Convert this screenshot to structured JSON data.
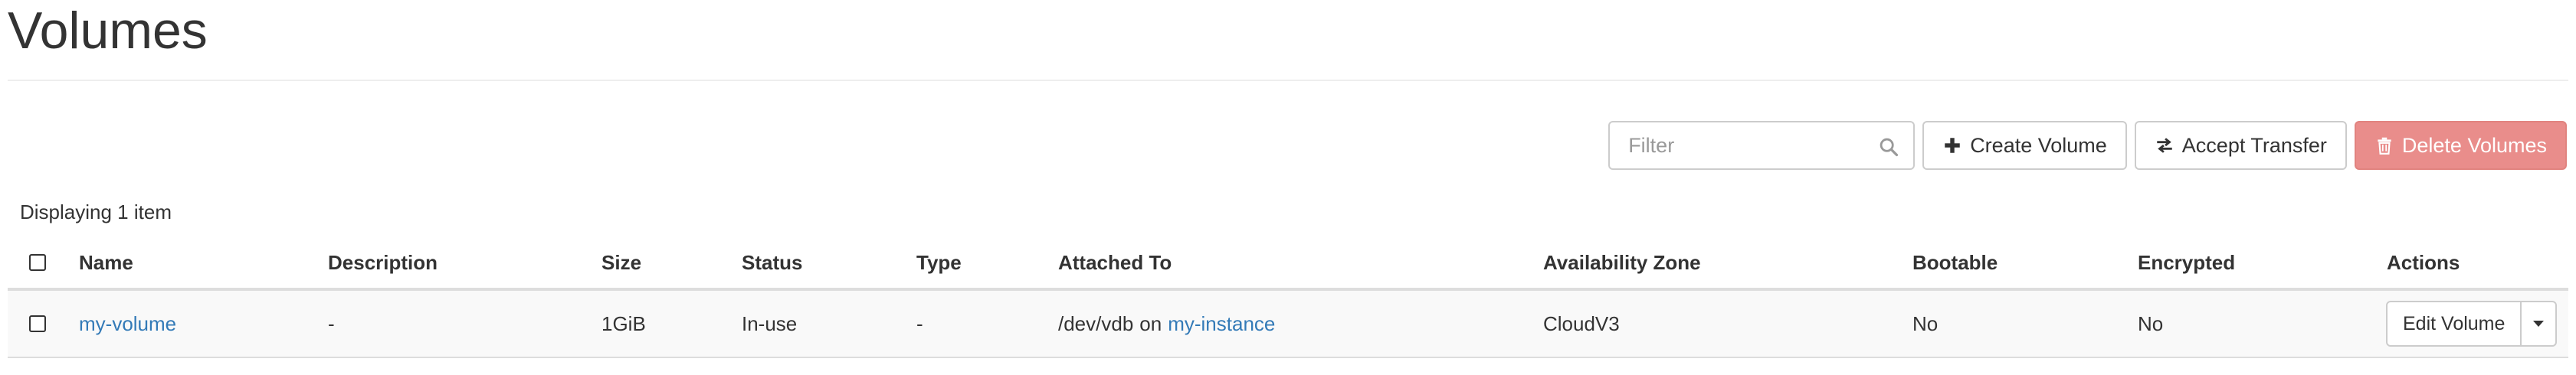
{
  "page": {
    "title": "Volumes"
  },
  "toolbar": {
    "filter_placeholder": "Filter",
    "create_label": "Create Volume",
    "accept_label": "Accept Transfer",
    "delete_label": "Delete Volumes"
  },
  "table": {
    "count_text": "Displaying 1 item",
    "headers": {
      "name": "Name",
      "description": "Description",
      "size": "Size",
      "status": "Status",
      "type": "Type",
      "attached": "Attached To",
      "zone": "Availability Zone",
      "bootable": "Bootable",
      "encrypted": "Encrypted",
      "actions": "Actions"
    },
    "rows": [
      {
        "name": "my-volume",
        "description": "-",
        "size": "1GiB",
        "status": "In-use",
        "type": "-",
        "attached_path": "/dev/vdb",
        "attached_on": "on",
        "attached_instance": "my-instance",
        "zone": "CloudV3",
        "bootable": "No",
        "encrypted": "No",
        "action_label": "Edit Volume"
      }
    ]
  },
  "icons": {
    "filter": "search-icon",
    "create": "plus-icon",
    "accept": "exchange-icon",
    "delete": "trash-icon",
    "dropdown": "caret-down-icon"
  },
  "colors": {
    "link": "#337ab7",
    "danger_button": "#e98d8b",
    "row_background": "#f9f9f9"
  }
}
